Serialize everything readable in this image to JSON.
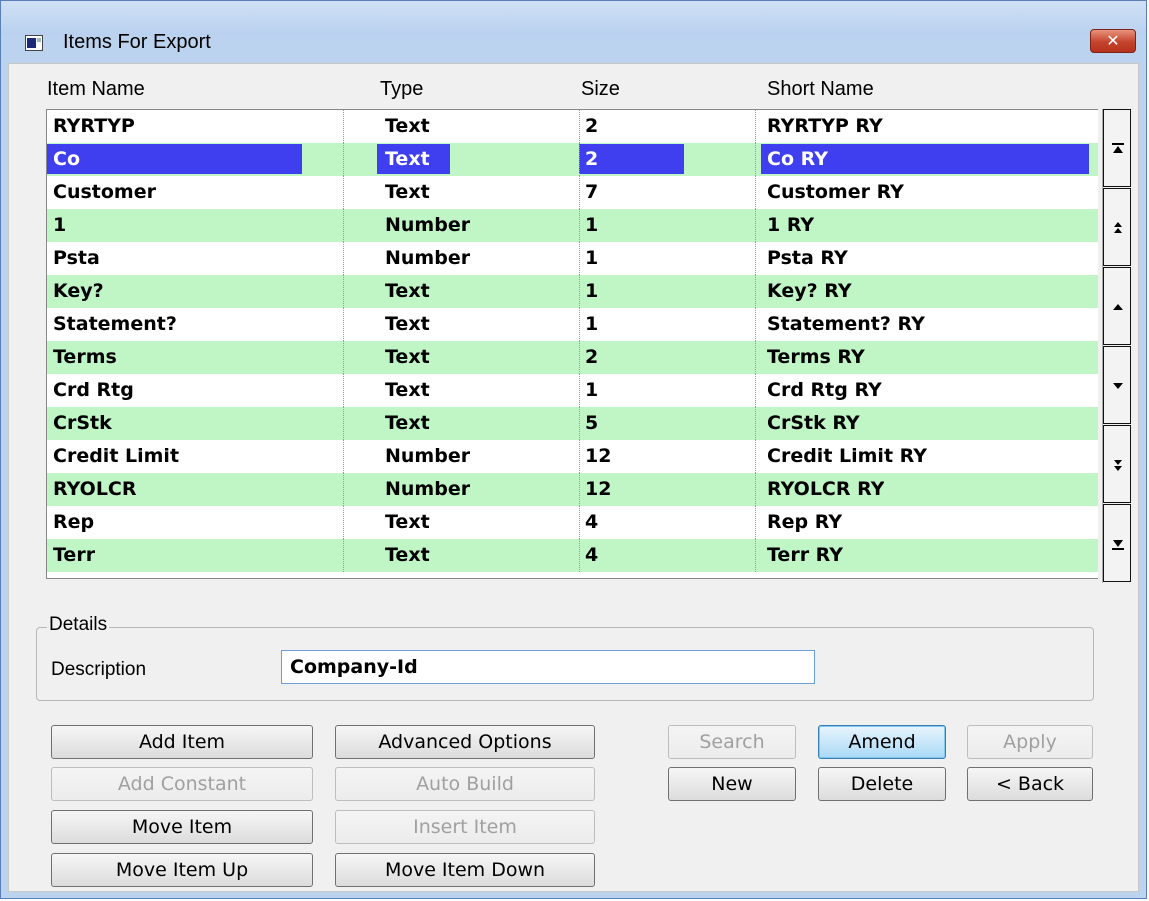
{
  "window": {
    "title": "Items For Export",
    "close_label": "✕"
  },
  "columns": [
    "Item Name",
    "Type",
    "Size",
    "Short Name"
  ],
  "rows": [
    {
      "name": "RYRTYP",
      "type": "Text",
      "size": "2",
      "short": "RYRTYP RY"
    },
    {
      "name": "Co",
      "type": "Text",
      "size": "2",
      "short": "Co RY"
    },
    {
      "name": "Customer",
      "type": "Text",
      "size": "7",
      "short": "Customer RY"
    },
    {
      "name": "1",
      "type": "Number",
      "size": "1",
      "short": "1 RY"
    },
    {
      "name": "Psta",
      "type": "Number",
      "size": "1",
      "short": "Psta RY"
    },
    {
      "name": "Key?",
      "type": "Text",
      "size": "1",
      "short": "Key? RY"
    },
    {
      "name": "Statement?",
      "type": "Text",
      "size": "1",
      "short": "Statement? RY"
    },
    {
      "name": "Terms",
      "type": "Text",
      "size": "2",
      "short": "Terms RY"
    },
    {
      "name": "Crd Rtg",
      "type": "Text",
      "size": "1",
      "short": "Crd Rtg RY"
    },
    {
      "name": "CrStk",
      "type": "Text",
      "size": "5",
      "short": "CrStk RY"
    },
    {
      "name": "Credit Limit",
      "type": "Number",
      "size": "12",
      "short": "Credit Limit RY"
    },
    {
      "name": "RYOLCR",
      "type": "Number",
      "size": "12",
      "short": "RYOLCR RY"
    },
    {
      "name": "Rep",
      "type": "Text",
      "size": "4",
      "short": "Rep RY"
    },
    {
      "name": "Terr",
      "type": "Text",
      "size": "4",
      "short": "Terr RY"
    }
  ],
  "selected_row": 1,
  "scroll_buttons": [
    "scroll-top",
    "page-up",
    "line-up",
    "line-down",
    "page-down",
    "scroll-bottom"
  ],
  "details": {
    "legend": "Details",
    "description_label": "Description",
    "description_value": "Company-Id"
  },
  "buttons": {
    "add_item": "Add Item",
    "advanced_options": "Advanced Options",
    "add_constant": "Add Constant",
    "auto_build": "Auto Build",
    "move_item": "Move Item",
    "insert_item": "Insert Item",
    "move_item_up": "Move Item Up",
    "move_item_down": "Move Item Down",
    "search": "Search",
    "amend": "Amend",
    "apply": "Apply",
    "new": "New",
    "delete": "Delete",
    "back": "< Back"
  },
  "colors": {
    "row_alt": "#c0f5c6",
    "selection": "#3f3ff0",
    "title_bg": "#bcd3ef"
  }
}
